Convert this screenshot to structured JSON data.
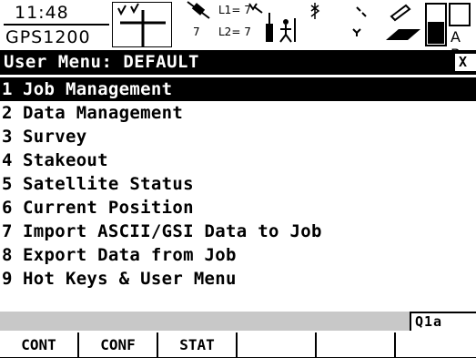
{
  "status": {
    "time": "11:48",
    "device": "GPS1200",
    "l1_label": "L1= 7",
    "l2_label": "L2= 7",
    "sat_count": "7",
    "memory_letters": "A B"
  },
  "title": "User Menu: DEFAULT",
  "close_label": "X",
  "menu": {
    "items": [
      {
        "num": "1",
        "label": "Job Management",
        "selected": true
      },
      {
        "num": "2",
        "label": "Data Management"
      },
      {
        "num": "3",
        "label": "Survey"
      },
      {
        "num": "4",
        "label": "Stakeout"
      },
      {
        "num": "5",
        "label": "Satellite Status"
      },
      {
        "num": "6",
        "label": "Current Position"
      },
      {
        "num": "7",
        "label": "Import ASCII/GSI Data to Job"
      },
      {
        "num": "8",
        "label": "Export Data from Job"
      },
      {
        "num": "9",
        "label": "Hot Keys & User Menu"
      }
    ]
  },
  "input_mode": "Q1a",
  "fkeys": [
    {
      "label": "CONT"
    },
    {
      "label": "CONF"
    },
    {
      "label": "STAT"
    },
    {
      "label": ""
    },
    {
      "label": ""
    },
    {
      "label": ""
    }
  ]
}
